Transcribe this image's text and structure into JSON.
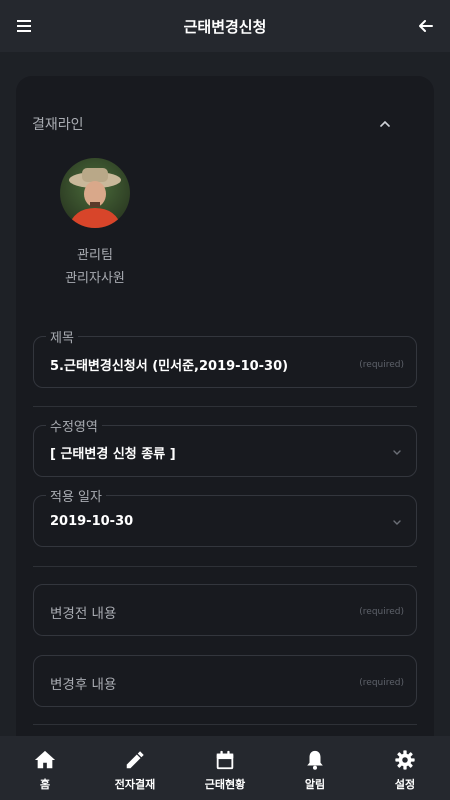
{
  "header": {
    "title": "근태변경신청",
    "menu_icon": "hamburger-menu-icon",
    "back_icon": "arrow-left-icon"
  },
  "approval_line": {
    "label": "결재라인",
    "toggle_icon": "chevron-up-icon",
    "approver": {
      "team": "관리팀",
      "title": "관리자사원"
    }
  },
  "form": {
    "subject": {
      "legend": "제목",
      "value": "5.근태변경신청서 (민서준,2019-10-30)",
      "required": "(required)"
    },
    "edit_area": {
      "legend": "수정영역",
      "value": "[ 근태변경 신청 종류 ]"
    },
    "apply_date": {
      "legend": "적용 일자",
      "value": "2019-10-30"
    },
    "before_content": {
      "placeholder": "변경전 내용",
      "required": "(required)"
    },
    "after_content": {
      "placeholder": "변경후 내용",
      "required": "(required)"
    }
  },
  "bottom_nav": [
    {
      "label": "홈",
      "icon": "home-icon"
    },
    {
      "label": "전자결재",
      "icon": "pencil-icon"
    },
    {
      "label": "근태현황",
      "icon": "calendar-icon"
    },
    {
      "label": "알림",
      "icon": "bell-icon"
    },
    {
      "label": "설정",
      "icon": "gear-icon"
    }
  ],
  "colors": {
    "background": "#1e2126",
    "card": "#181a1f",
    "bar": "#25282e",
    "text": "#ffffff",
    "muted": "#a9acb2"
  }
}
